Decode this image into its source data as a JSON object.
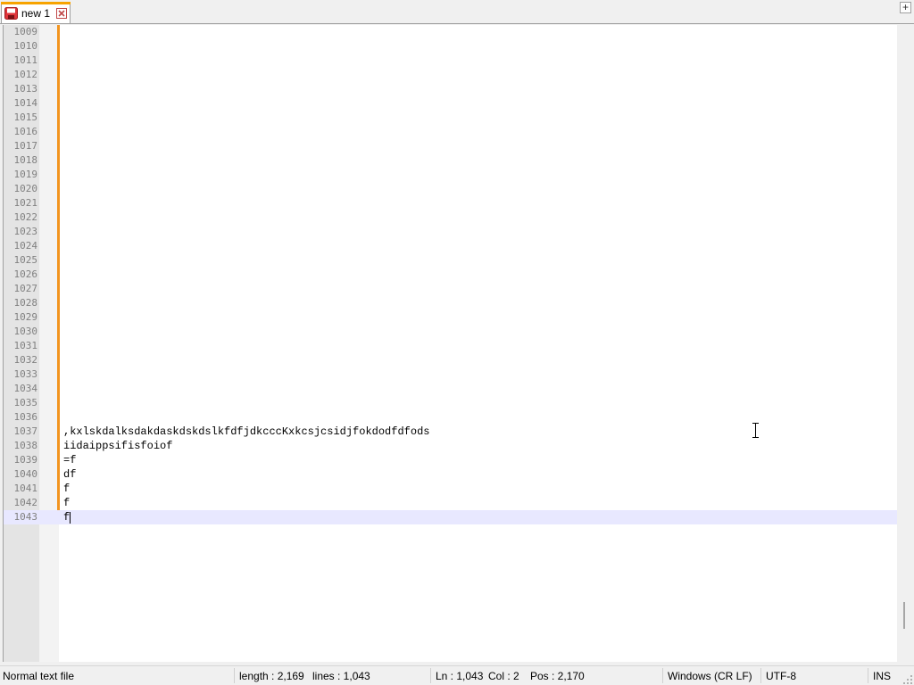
{
  "tab": {
    "label": "new 1",
    "icon": "unsaved-file-icon",
    "close_icon": "close-icon",
    "accent": "#f7a300"
  },
  "add_tab_label": "+",
  "editor": {
    "lines": [
      {
        "num": "1009",
        "text": ""
      },
      {
        "num": "1010",
        "text": ""
      },
      {
        "num": "1011",
        "text": ""
      },
      {
        "num": "1012",
        "text": ""
      },
      {
        "num": "1013",
        "text": ""
      },
      {
        "num": "1014",
        "text": ""
      },
      {
        "num": "1015",
        "text": ""
      },
      {
        "num": "1016",
        "text": ""
      },
      {
        "num": "1017",
        "text": ""
      },
      {
        "num": "1018",
        "text": ""
      },
      {
        "num": "1019",
        "text": ""
      },
      {
        "num": "1020",
        "text": ""
      },
      {
        "num": "1021",
        "text": ""
      },
      {
        "num": "1022",
        "text": ""
      },
      {
        "num": "1023",
        "text": ""
      },
      {
        "num": "1024",
        "text": ""
      },
      {
        "num": "1025",
        "text": ""
      },
      {
        "num": "1026",
        "text": ""
      },
      {
        "num": "1027",
        "text": ""
      },
      {
        "num": "1028",
        "text": ""
      },
      {
        "num": "1029",
        "text": ""
      },
      {
        "num": "1030",
        "text": ""
      },
      {
        "num": "1031",
        "text": ""
      },
      {
        "num": "1032",
        "text": ""
      },
      {
        "num": "1033",
        "text": ""
      },
      {
        "num": "1034",
        "text": ""
      },
      {
        "num": "1035",
        "text": ""
      },
      {
        "num": "1036",
        "text": ""
      },
      {
        "num": "1037",
        "text": ",kxlskdalksdakdaskdskdslkfdfjdkcccKxkcsjcsidjfokdodfdfods"
      },
      {
        "num": "1038",
        "text": "iidaippsifisfoiof"
      },
      {
        "num": "1039",
        "text": "=f"
      },
      {
        "num": "1040",
        "text": "df"
      },
      {
        "num": "1041",
        "text": "f"
      },
      {
        "num": "1042",
        "text": "f"
      },
      {
        "num": "1043",
        "text": "f"
      }
    ],
    "current_line_color": "#e8e8ff",
    "change_marker_color": "#f2941f"
  },
  "status": {
    "file_type": "Normal text file",
    "length": "length : 2,169",
    "lines": "lines : 1,043",
    "ln": "Ln : 1,043",
    "col": "Col : 2",
    "pos": "Pos : 2,170",
    "eol": "Windows (CR LF)",
    "encoding": "UTF-8",
    "mode": "INS"
  }
}
